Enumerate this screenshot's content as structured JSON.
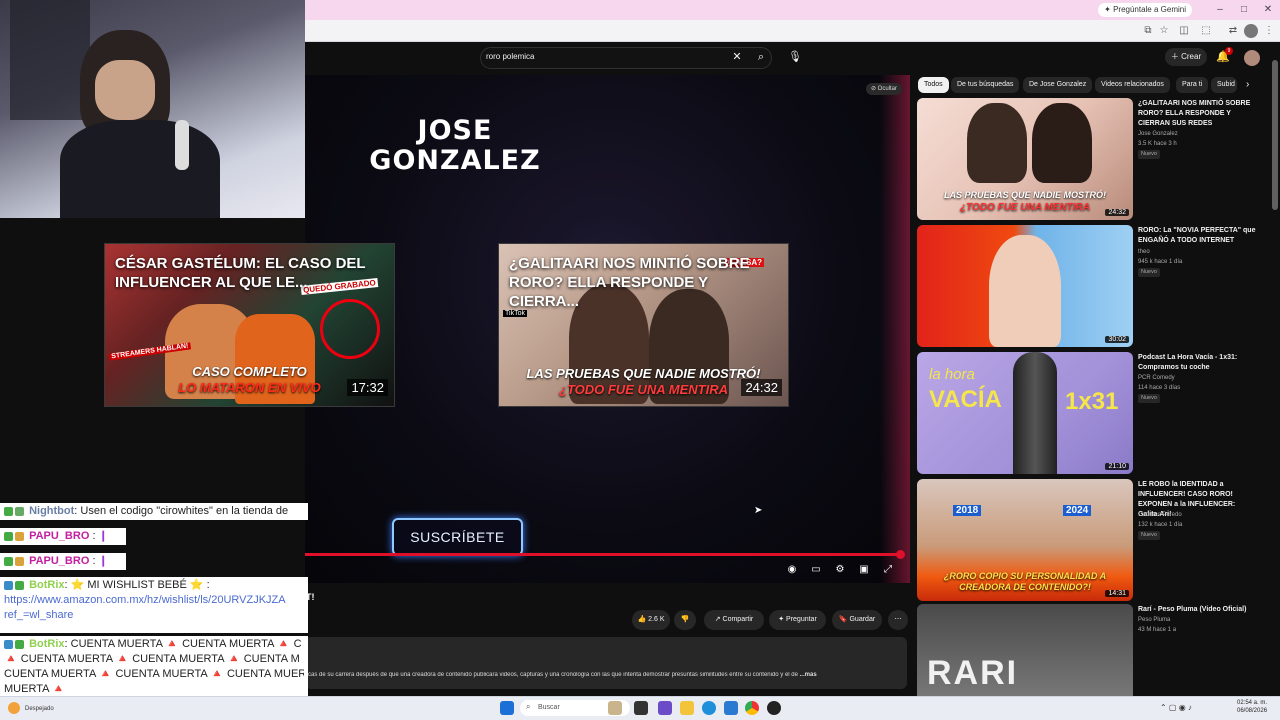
{
  "browser": {
    "gemini_label": "Pregúntale a Gemini",
    "window_controls": [
      "–",
      "□",
      "✕"
    ]
  },
  "header": {
    "search_query": "roro polemica",
    "create_label": "Crear",
    "notif_count": "9"
  },
  "player": {
    "channel_title": "JOSE GONZALEZ",
    "hide_label": "Ocultar",
    "subscribe_label": "SUSCRÍBETE",
    "endcards": [
      {
        "title": "CÉSAR GASTÉLUM: EL CASO DEL INFLUENCER AL QUE LE...",
        "caption_top": "CASO COMPLETO",
        "caption_bottom": "LO MATARON EN VIVO",
        "duration": "17:32",
        "tag1": "QUEDÓ GRABADO",
        "tag2": "STREAMERS HABLAN!"
      },
      {
        "title": "¿GALITAARI NOS MINTIÓ SOBRE RORO? ELLA RESPONDE Y CIERRA...",
        "caption_top": "LAS PRUEBAS QUE NADIE MOSTRÓ!",
        "caption_bottom": "¿TODO FUE UNA MENTIRA",
        "duration": "24:32",
        "tag1": "¿FALSA?",
        "tag2": "TikTok"
      }
    ]
  },
  "below": {
    "title_fragment": "T!",
    "likes": "2.6 K",
    "share": "Compartir",
    "ask": "Preguntar",
    "save": "Guardar",
    "description": "cas de su carrera después de que una creadora de contenido publicara videos, capturas y una cronología con las que intenta demostrar presuntas similitudes entre su contenido y el de",
    "more": "...más"
  },
  "sidebar": {
    "chips": [
      "Todos",
      "De tus búsquedas",
      "De Jose Gonzalez",
      "Videos relacionados",
      "Para ti",
      "Subid"
    ],
    "videos": [
      {
        "title": "¿GALITAARI NOS MINTIÓ SOBRE RORO? ELLA RESPONDE Y CIERRAN SUS REDES",
        "channel": "Jose Gonzalez",
        "meta": "3.5 K  hace 3 h",
        "badge": "Nuevo",
        "duration": "24:32",
        "caption_top": "LAS PRUEBAS QUE NADIE MOSTRÓ!",
        "caption_bottom": "¿TODO FUE UNA MENTIRA"
      },
      {
        "title": "RORO: La \"NOVIA PERFECTA\" que ENGAÑÓ A TODO INTERNET",
        "channel": "theo",
        "meta": "945 k  hace 1 día",
        "badge": "Nuevo",
        "duration": "30:02"
      },
      {
        "title": "Podcast La Hora Vacía - 1x31: Compramos tu coche",
        "channel": "PCR Comedy",
        "meta": "114  hace 3 días",
        "badge": "Nuevo",
        "duration": "21:10",
        "thumb_text_a": "la hora",
        "thumb_text_b": "VACÍA",
        "thumb_text_c": "1x31"
      },
      {
        "title": "LE ROBO la IDENTIDAD a INFLUENCER! CASO RORO! EXPONEN a la INFLUENCER: Galita.Ari!",
        "channel": "Candres Peredo",
        "meta": "132 k  hace 1 día",
        "badge": "Nuevo",
        "duration": "14:31",
        "year_a": "2018",
        "year_b": "2024",
        "caption": "¿RORO COPIO SU PERSONALIDAD A CREADORA DE CONTENIDO?!"
      },
      {
        "title": "Rarí - Peso Pluma (Video Oficial)",
        "channel": "Peso Pluma",
        "meta": "43 M  hace 1 a",
        "thumb_text": "RARI"
      }
    ]
  },
  "chat": {
    "messages": [
      {
        "user": "Nightbot",
        "text": ": Usen el codigo \"cirowhites\" en la tienda de"
      },
      {
        "user": "PAPU_BRO",
        "text": ":"
      },
      {
        "user": "PAPU_BRO",
        "text": ":"
      },
      {
        "user": "BotRix",
        "text": ": ⭐ MI WISHLIST BEBÉ ⭐ :",
        "link": "https://www.amazon.com.mx/hz/wishlist/ls/20URVZJKJZA",
        "link2": "ref_=wl_share"
      },
      {
        "user": "BotRix",
        "text": ": CUENTA MUERTA 🔺 CUENTA MUERTA 🔺 C",
        "line2": "🔺 CUENTA MUERTA 🔺 CUENTA MUERTA 🔺 CUENTA M",
        "line3": "CUENTA MUERTA 🔺 CUENTA MUERTA 🔺 CUENTA MUER",
        "line4": "MUERTA 🔺"
      }
    ]
  },
  "taskbar": {
    "weather": "Despejado",
    "search": "Buscar",
    "time": "02:54 a. m.",
    "date": "06/08/2026"
  },
  "colors": {
    "yt_red": "#e0102a",
    "accent_blue": "#3d7fff",
    "chrome_pink": "#f7d7ee"
  }
}
